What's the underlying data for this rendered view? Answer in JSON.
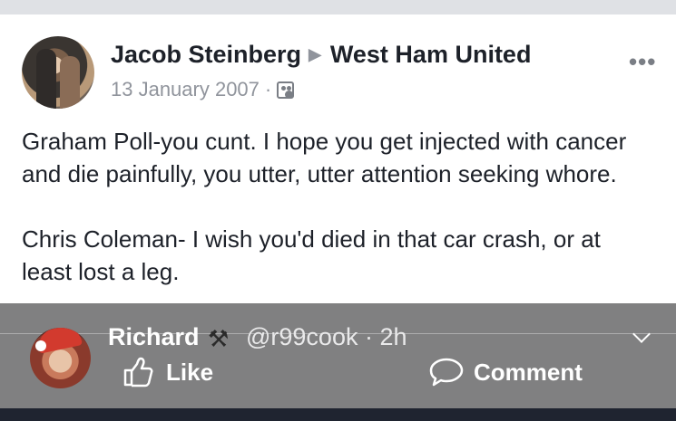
{
  "post": {
    "author": "Jacob Steinberg",
    "target": "West Ham United",
    "date": "13 January 2007",
    "separator": "·",
    "more": "•••",
    "body": [
      "Graham Poll-you cunt. I hope you get injected with cancer and die painfully, you utter, utter attention seeking whore.",
      "Chris Coleman- I wish you'd died in that car crash, or at least lost a leg."
    ]
  },
  "retweet": {
    "name": "Richard",
    "emoji": "⚒",
    "handle": "@r99cook",
    "time": "· 2h"
  },
  "actions": {
    "like_label": "Like",
    "comment_label": "Comment"
  },
  "icons": [
    "audience-icon",
    "more-icon",
    "chevron-down-icon",
    "like-icon",
    "comment-icon"
  ],
  "colors": {
    "text": "#1d2129",
    "meta": "#90949c",
    "overlay": "#6e6e70",
    "bottom_bar": "#1f2430"
  }
}
